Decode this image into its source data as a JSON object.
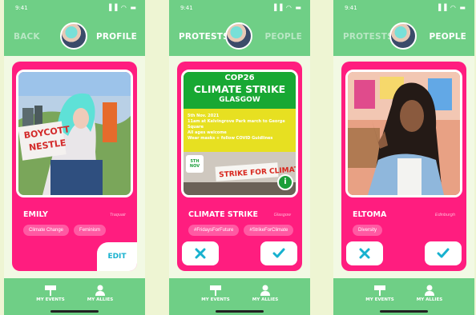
{
  "status": {
    "time": "9:41",
    "icons": "▐▐ ◠ ▬"
  },
  "screens": [
    {
      "nav_left": "BACK",
      "nav_right": "PROFILE",
      "card": {
        "name": "EMILY",
        "location": "Traquair",
        "tags": [
          "Climate Change",
          "Feminism"
        ],
        "action": "EDIT",
        "photo_signs": [
          "BOYCOTT",
          "NESTLE"
        ]
      }
    },
    {
      "nav_left": "PROTESTS",
      "nav_right": "PEOPLE",
      "card": {
        "name": "CLIMATE STRIKE",
        "location": "Glasgow",
        "tags": [
          "#FridaysForFuture",
          "#StrikeForClimate"
        ],
        "poster": {
          "line1": "COP26",
          "line2": "CLIMATE STRIKE",
          "line3": "GLASGOW",
          "info": [
            "5th Nov. 2021",
            "11am at Kelvingrove Park march to George Square",
            "All ages welcome",
            "Wear masks + follow COVID Guidlines"
          ],
          "date": "5TH NOV",
          "banner": "STRIKE FOR CLIMATE",
          "badge": "i"
        }
      }
    },
    {
      "nav_left": "PROTESTS",
      "nav_right": "PEOPLE",
      "card": {
        "name": "ELTOMA",
        "location": "Edinburgh",
        "tags": [
          "Diversity"
        ]
      }
    }
  ],
  "bottom_nav": {
    "events": "MY EVENTS",
    "allies": "MY ALLIES"
  },
  "icons": {
    "reject": "close-icon",
    "accept": "check-icon",
    "events": "signpost-icon",
    "allies": "person-icon"
  },
  "colors": {
    "green": "#6fcf86",
    "pink": "#ff1d7f",
    "blue": "#17b1cf"
  }
}
